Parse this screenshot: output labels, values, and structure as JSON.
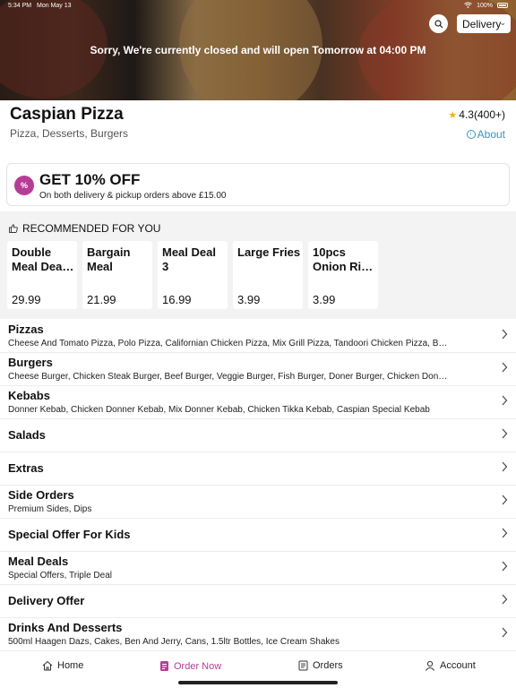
{
  "status_bar": {
    "time": "5:34 PM",
    "date": "Mon May 13",
    "battery": "100%"
  },
  "header": {
    "delivery_mode": "Delivery",
    "closed_message": "Sorry, We're currently closed and will open Tomorrow at 04:00 PM"
  },
  "restaurant": {
    "name": "Caspian Pizza",
    "cuisines": "Pizza, Desserts, Burgers",
    "rating": "4.3(400+)",
    "about_label": "About"
  },
  "offer": {
    "badge": "%",
    "title": "GET 10% OFF",
    "subtitle": "On both delivery & pickup orders above £15.00"
  },
  "recommended": {
    "heading": "RECOMMENDED FOR YOU",
    "items": [
      {
        "line1": "Double",
        "line2": "Meal Dea…",
        "price": "29.99"
      },
      {
        "line1": "Bargain",
        "line2": "Meal",
        "price": "21.99"
      },
      {
        "line1": "Meal Deal",
        "line2": "3",
        "price": "16.99"
      },
      {
        "line1": "Large Fries",
        "line2": "",
        "price": "3.99"
      },
      {
        "line1": "10pcs",
        "line2": "Onion Rin…",
        "price": "3.99"
      }
    ]
  },
  "categories": [
    {
      "title": "Pizzas",
      "desc": "Cheese And Tomato Pizza, Polo Pizza, Californian Chicken Pizza, Mix Grill Pizza, Tandoori Chicken Pizza, B…"
    },
    {
      "title": "Burgers",
      "desc": "Cheese Burger, Chicken Steak Burger, Beef Burger, Veggie Burger, Fish Burger, Doner Burger, Chicken Don…"
    },
    {
      "title": "Kebabs",
      "desc": "Donner Kebab, Chicken Donner Kebab, Mix Donner Kebab, Chicken Tikka Kebab, Caspian Special Kebab"
    },
    {
      "title": "Salads",
      "desc": ""
    },
    {
      "title": "Extras",
      "desc": ""
    },
    {
      "title": "Side Orders",
      "desc": "Premium Sides, Dips"
    },
    {
      "title": "Special Offer For Kids",
      "desc": ""
    },
    {
      "title": "Meal Deals",
      "desc": "Special Offers, Triple Deal"
    },
    {
      "title": "Delivery Offer",
      "desc": ""
    },
    {
      "title": "Drinks And Desserts",
      "desc": "500ml Haagen Dazs, Cakes, Ben And Jerry, Cans, 1.5ltr Bottles, Ice Cream Shakes"
    }
  ],
  "tabbar": [
    {
      "label": "Home",
      "icon": "home-icon",
      "active": false
    },
    {
      "label": "Order Now",
      "icon": "order-icon",
      "active": true
    },
    {
      "label": "Orders",
      "icon": "receipt-icon",
      "active": false
    },
    {
      "label": "Account",
      "icon": "user-icon",
      "active": false
    }
  ],
  "colors": {
    "accent": "#b63d97",
    "link": "#3b93c2",
    "star": "#f0b400"
  }
}
